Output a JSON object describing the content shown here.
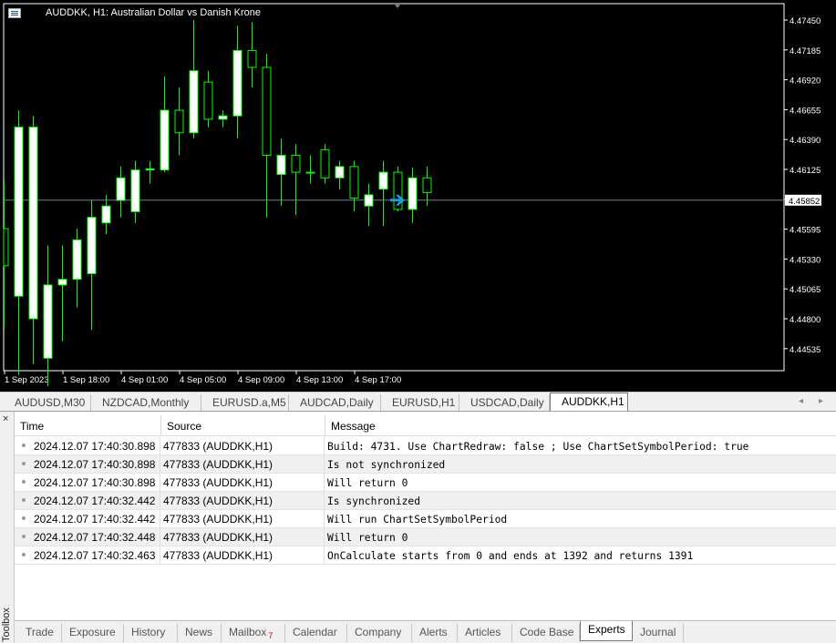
{
  "chart": {
    "title": "AUDDKK, H1:  Australian Dollar vs Danish Krone",
    "current_price_label": "4.45852",
    "colors": {
      "background": "#000000",
      "candle": "#00ff00",
      "bull_body": "#ffffff",
      "bear_body": "#000000",
      "price_line": "#6e7f93",
      "arrow": "#1e9be8",
      "price_box": "#ffffff"
    },
    "icons": [
      "chart-window-icon",
      "flag-icon"
    ]
  },
  "chart_data": {
    "type": "candlestick",
    "title": "AUDDKK, H1:  Australian Dollar vs Danish Krone",
    "y_ticks": [
      "4.47450",
      "4.47185",
      "4.46920",
      "4.46655",
      "4.46390",
      "4.46125",
      "4.45860",
      "4.45595",
      "4.45330",
      "4.45065",
      "4.44800",
      "4.44535"
    ],
    "x_ticks": [
      "1 Sep 2023",
      "1 Sep 18:00",
      "4 Sep 01:00",
      "4 Sep 05:00",
      "4 Sep 09:00",
      "4 Sep 13:00",
      "4 Sep 17:00"
    ],
    "ylim": [
      4.4425,
      4.4758
    ],
    "current_price": 4.45852,
    "candles": [
      {
        "o": 4.456,
        "h": 4.4603,
        "l": 4.447,
        "c": 4.4527
      },
      {
        "o": 4.45,
        "h": 4.4665,
        "l": 4.443,
        "c": 4.465
      },
      {
        "o": 4.448,
        "h": 4.466,
        "l": 4.444,
        "c": 4.465
      },
      {
        "o": 4.4445,
        "h": 4.4545,
        "l": 4.442,
        "c": 4.451
      },
      {
        "o": 4.451,
        "h": 4.4545,
        "l": 4.446,
        "c": 4.4515
      },
      {
        "o": 4.4515,
        "h": 4.456,
        "l": 4.449,
        "c": 4.455
      },
      {
        "o": 4.452,
        "h": 4.4585,
        "l": 4.447,
        "c": 4.457
      },
      {
        "o": 4.4565,
        "h": 4.459,
        "l": 4.4555,
        "c": 4.458
      },
      {
        "o": 4.4585,
        "h": 4.4615,
        "l": 4.457,
        "c": 4.4605
      },
      {
        "o": 4.4575,
        "h": 4.462,
        "l": 4.4565,
        "c": 4.4612
      },
      {
        "o": 4.4612,
        "h": 4.462,
        "l": 4.46,
        "c": 4.4613
      },
      {
        "o": 4.4612,
        "h": 4.4695,
        "l": 4.461,
        "c": 4.4665
      },
      {
        "o": 4.4665,
        "h": 4.4685,
        "l": 4.4625,
        "c": 4.4645
      },
      {
        "o": 4.4645,
        "h": 4.4745,
        "l": 4.464,
        "c": 4.47
      },
      {
        "o": 4.469,
        "h": 4.47,
        "l": 4.465,
        "c": 4.4657
      },
      {
        "o": 4.4657,
        "h": 4.4665,
        "l": 4.465,
        "c": 4.466
      },
      {
        "o": 4.466,
        "h": 4.474,
        "l": 4.464,
        "c": 4.4718
      },
      {
        "o": 4.4718,
        "h": 4.4743,
        "l": 4.4685,
        "c": 4.4703
      },
      {
        "o": 4.4703,
        "h": 4.4715,
        "l": 4.457,
        "c": 4.4625
      },
      {
        "o": 4.4608,
        "h": 4.464,
        "l": 4.458,
        "c": 4.4625
      },
      {
        "o": 4.4625,
        "h": 4.4635,
        "l": 4.4572,
        "c": 4.461
      },
      {
        "o": 4.461,
        "h": 4.4625,
        "l": 4.46,
        "c": 4.461
      },
      {
        "o": 4.463,
        "h": 4.4635,
        "l": 4.46,
        "c": 4.4605
      },
      {
        "o": 4.4605,
        "h": 4.462,
        "l": 4.4595,
        "c": 4.4615
      },
      {
        "o": 4.4615,
        "h": 4.462,
        "l": 4.4575,
        "c": 4.4587
      },
      {
        "o": 4.458,
        "h": 4.46,
        "l": 4.4562,
        "c": 4.459
      },
      {
        "o": 4.4595,
        "h": 4.462,
        "l": 4.4562,
        "c": 4.461
      },
      {
        "o": 4.461,
        "h": 4.4615,
        "l": 4.4575,
        "c": 4.4577
      },
      {
        "o": 4.4577,
        "h": 4.4614,
        "l": 4.4565,
        "c": 4.4605
      },
      {
        "o": 4.4605,
        "h": 4.4615,
        "l": 4.458,
        "c": 4.4592
      }
    ]
  },
  "chart_tabs": [
    "AUDUSD,M30",
    "NZDCAD,Monthly",
    "EURUSD.a,M5",
    "AUDCAD,Daily",
    "EURUSD,H1",
    "USDCAD,Daily",
    "AUDDKK,H1"
  ],
  "chart_tabs_active": "AUDDKK,H1",
  "toolbox": {
    "label": "Toolbox",
    "close": "×"
  },
  "log": {
    "headers": {
      "time": "Time",
      "source": "Source",
      "message": "Message"
    },
    "rows": [
      {
        "time": "2024.12.07 17:40:30.898",
        "source": "477833 (AUDDKK,H1)",
        "message": "Build: 4731. Use ChartRedraw: false ; Use ChartSetSymbolPeriod: true"
      },
      {
        "time": "2024.12.07 17:40:30.898",
        "source": "477833 (AUDDKK,H1)",
        "message": "Is not synchronized"
      },
      {
        "time": "2024.12.07 17:40:30.898",
        "source": "477833 (AUDDKK,H1)",
        "message": "Will return 0"
      },
      {
        "time": "2024.12.07 17:40:32.442",
        "source": "477833 (AUDDKK,H1)",
        "message": "Is synchronized"
      },
      {
        "time": "2024.12.07 17:40:32.442",
        "source": "477833 (AUDDKK,H1)",
        "message": "Will run ChartSetSymbolPeriod"
      },
      {
        "time": "2024.12.07 17:40:32.448",
        "source": "477833 (AUDDKK,H1)",
        "message": "Will return 0"
      },
      {
        "time": "2024.12.07 17:40:32.463",
        "source": "477833 (AUDDKK,H1)",
        "message": "OnCalculate starts from 0 and ends at 1392 and returns 1391"
      }
    ]
  },
  "bottom_tabs": [
    "Trade",
    "Exposure",
    "History",
    "News",
    "Mailbox",
    "Calendar",
    "Company",
    "Alerts",
    "Articles",
    "Code Base",
    "Experts",
    "Journal"
  ],
  "mailbox_badge": "7",
  "bottom_tabs_active": "Experts"
}
